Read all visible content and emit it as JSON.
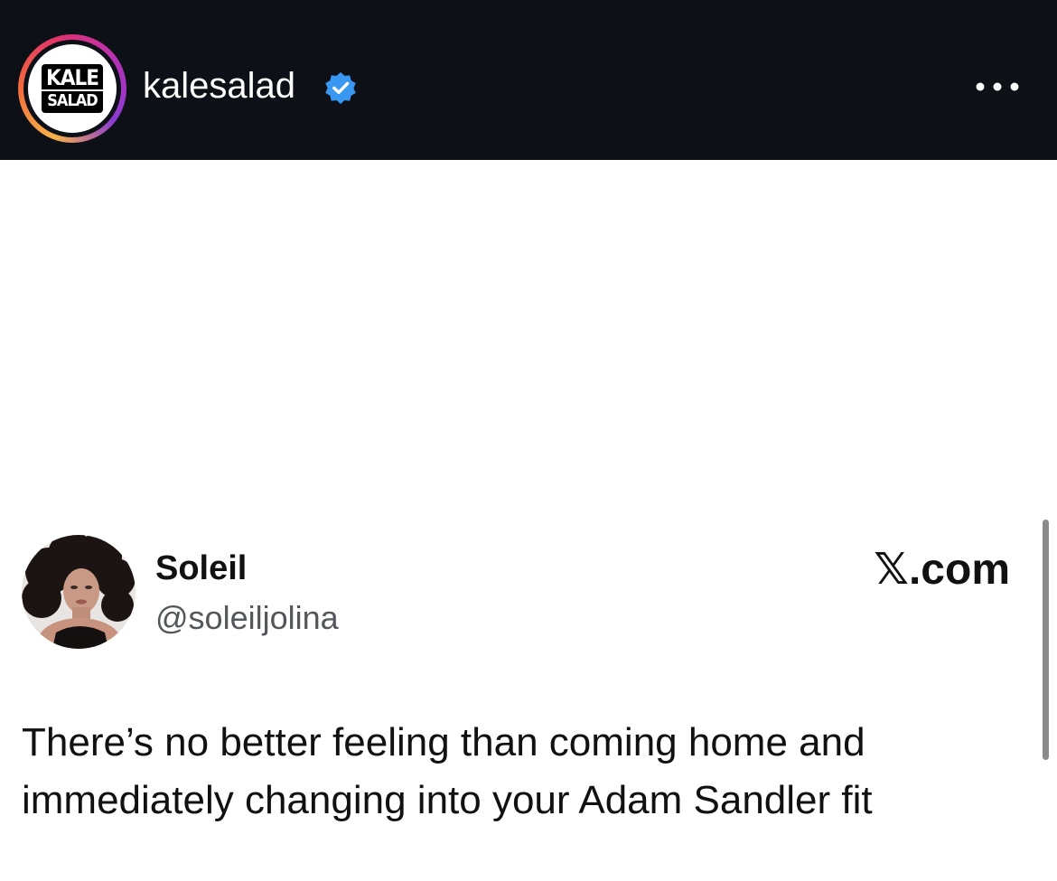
{
  "header": {
    "username": "kalesalad",
    "verified_icon": "verified-badge-icon",
    "more_icon": "more-options-icon",
    "logo": {
      "line1": "KALE",
      "line2": "SALAD"
    },
    "colors": {
      "background": "#0d1017",
      "verified": "#3897f0"
    }
  },
  "tweet": {
    "display_name": "Soleil",
    "handle": "@soleiljolina",
    "source": "𝕏.com",
    "text": "There’s no better feeling than coming home and\nimmediately changing into your Adam Sandler fit"
  }
}
